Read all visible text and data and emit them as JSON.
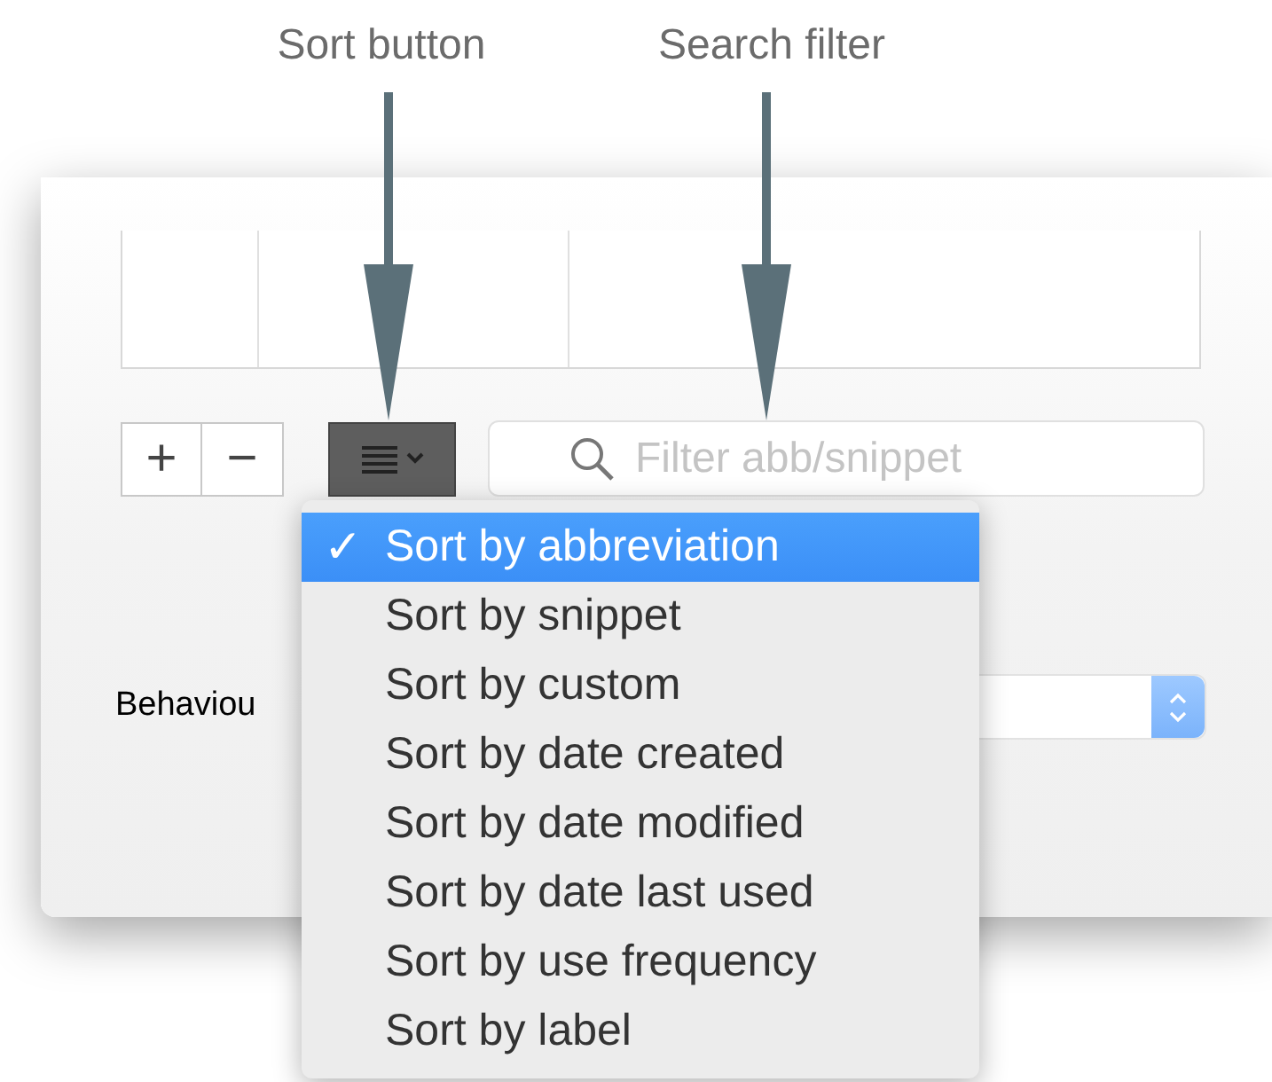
{
  "annotations": [
    {
      "label": "Sort button"
    },
    {
      "label": "Search filter"
    }
  ],
  "table_buttons": [
    "+",
    "−"
  ],
  "search": {
    "placeholder": "Filter abb/snippet"
  },
  "behaviour": {
    "label": "Behaviou"
  },
  "sort_menu": {
    "check_mark": "✓",
    "items": [
      {
        "label": "Sort by abbreviation",
        "checked": true,
        "selected": true
      },
      {
        "label": "Sort by snippet",
        "checked": false,
        "selected": false
      },
      {
        "label": "Sort by custom",
        "checked": false,
        "selected": false
      },
      {
        "label": "Sort by date created",
        "checked": false,
        "selected": false
      },
      {
        "label": "Sort by date modified",
        "checked": false,
        "selected": false
      },
      {
        "label": "Sort by date last used",
        "checked": false,
        "selected": false
      },
      {
        "label": "Sort by use frequency",
        "checked": false,
        "selected": false
      },
      {
        "label": "Sort by label",
        "checked": false,
        "selected": false
      }
    ]
  }
}
